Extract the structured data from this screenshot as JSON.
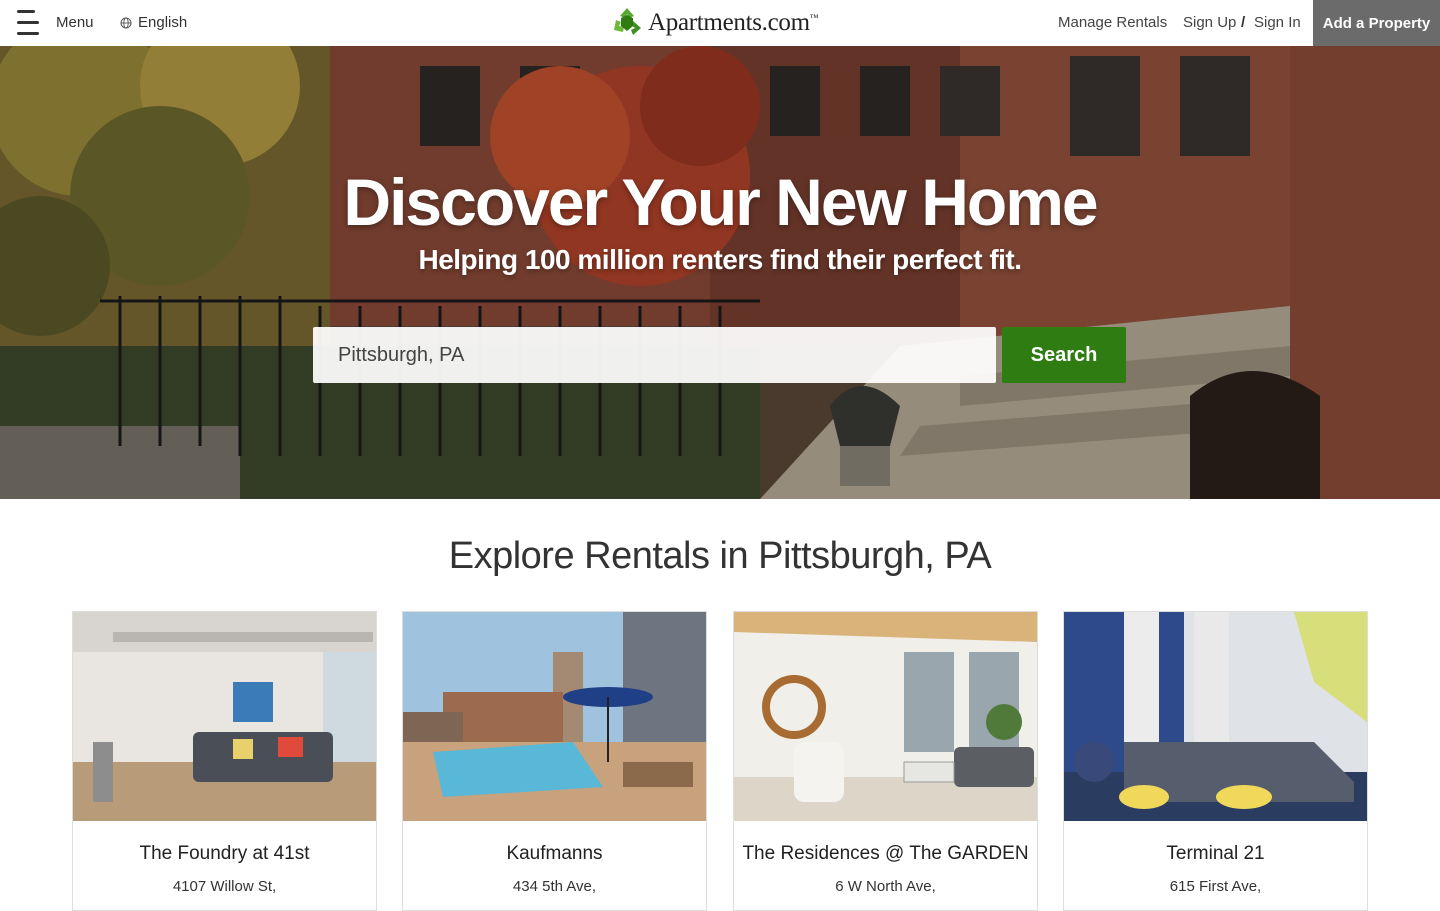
{
  "header": {
    "menu_label": "Menu",
    "language": "English",
    "logo_text": "Apartments.com",
    "logo_tm": "™",
    "manage_rentals": "Manage Rentals",
    "sign_up": "Sign Up",
    "separator": "/",
    "sign_in": "Sign In",
    "add_property": "Add a Property"
  },
  "hero": {
    "title": "Discover Your New Home",
    "subtitle": "Helping 100 million renters find their perfect fit.",
    "search_value": "Pittsburgh, PA",
    "search_button": "Search"
  },
  "explore": {
    "title": "Explore Rentals in Pittsburgh, PA",
    "cards": [
      {
        "name": "The Foundry at 41st",
        "address": "4107 Willow St,"
      },
      {
        "name": "Kaufmanns",
        "address": "434 5th Ave,"
      },
      {
        "name": "The Residences @ The GARDEN",
        "address": "6 W North Ave,"
      },
      {
        "name": "Terminal 21",
        "address": "615 First Ave,"
      }
    ]
  },
  "colors": {
    "brand_green": "#2f7d12",
    "add_property_bg": "#6b6b6b"
  }
}
